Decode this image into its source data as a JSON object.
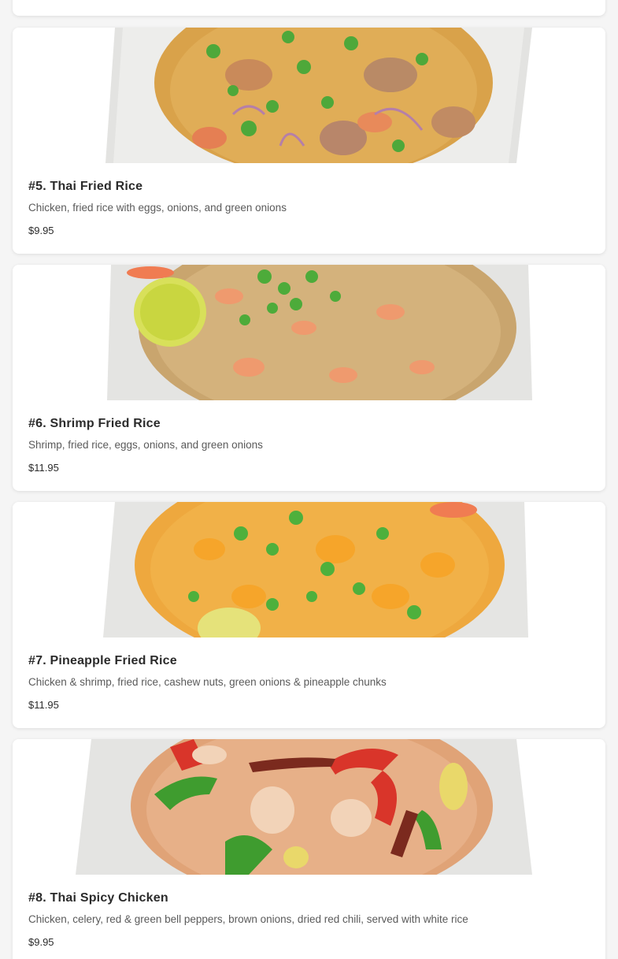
{
  "menu_items": [
    {
      "title": "#5. Thai Fried Rice",
      "description": "Chicken, fried rice with eggs, onions, and green onions",
      "price": "$9.95",
      "image_icon": "thai-fried-rice-photo"
    },
    {
      "title": "#6. Shrimp Fried Rice",
      "description": "Shrimp, fried rice, eggs, onions, and green onions",
      "price": "$11.95",
      "image_icon": "shrimp-fried-rice-photo"
    },
    {
      "title": "#7. Pineapple Fried Rice",
      "description": "Chicken & shrimp, fried rice, cashew nuts, green onions & pineapple chunks",
      "price": "$11.95",
      "image_icon": "pineapple-fried-rice-photo"
    },
    {
      "title": "#8. Thai Spicy Chicken",
      "description": "Chicken, celery, red & green bell peppers, brown onions, dried red chili, served with white rice",
      "price": "$9.95",
      "image_icon": "thai-spicy-chicken-photo"
    }
  ],
  "colors": {
    "card_background": "#ffffff",
    "page_background": "#f5f5f5",
    "title_text": "#2b2b2b",
    "description_text": "#5a5a5a"
  }
}
